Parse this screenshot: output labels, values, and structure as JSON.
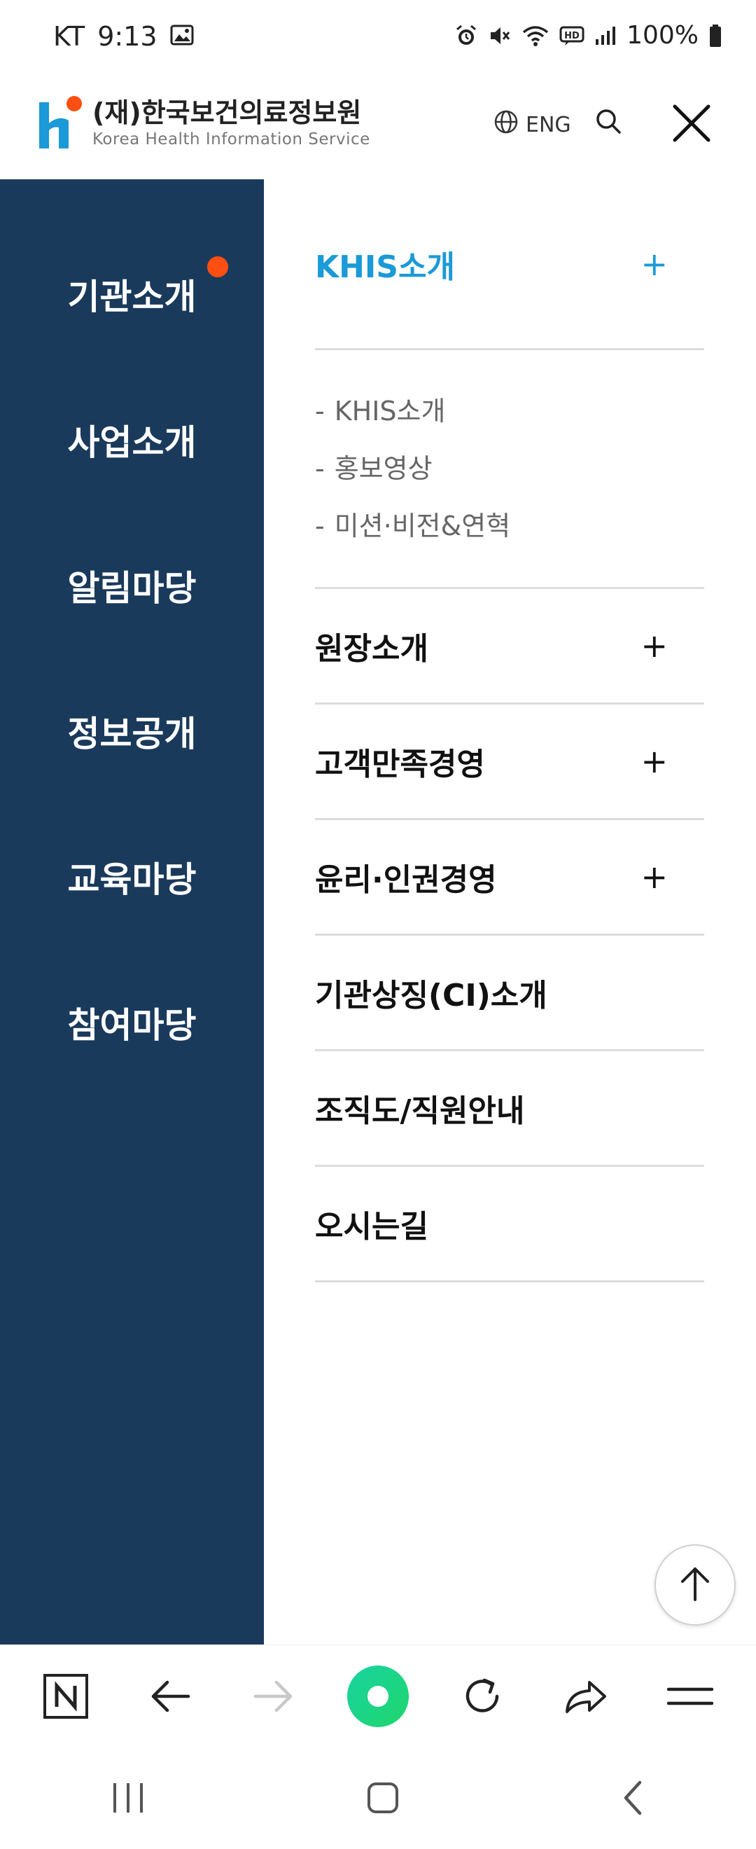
{
  "status_bar": {
    "carrier": "KT",
    "time": "9:13",
    "battery": "100%"
  },
  "header": {
    "logo_ko": "(재)한국보건의료정보원",
    "logo_en": "Korea Health Information Service",
    "lang_label": "ENG"
  },
  "sidebar": {
    "items": [
      {
        "label": "기관소개"
      },
      {
        "label": "사업소개"
      },
      {
        "label": "알림마당"
      },
      {
        "label": "정보공개"
      },
      {
        "label": "교육마당"
      },
      {
        "label": "참여마당"
      }
    ]
  },
  "menu": {
    "items": [
      {
        "label": "KHIS소개",
        "icon": "+"
      },
      {
        "label": "원장소개",
        "icon": "+"
      },
      {
        "label": "고객만족경영",
        "icon": "+"
      },
      {
        "label": "윤리·인권경영",
        "icon": "+"
      },
      {
        "label": "기관상징(CI)소개"
      },
      {
        "label": "조직도/직원안내"
      },
      {
        "label": "오시는길"
      }
    ],
    "sub_items": [
      {
        "dash": "-",
        "label": "KHIS소개"
      },
      {
        "dash": "-",
        "label": "홍보영상"
      },
      {
        "dash": "-",
        "label": "미션·비전&연혁"
      }
    ]
  },
  "colors": {
    "sidebar_bg": "#1a3a5c",
    "accent": "#1a9ad6",
    "notification_dot": "#ff4e12",
    "home_button": "#1fd68a"
  },
  "toolbar": {
    "icons": [
      "naver-icon",
      "back-arrow-icon",
      "forward-arrow-icon",
      "home-icon",
      "refresh-icon",
      "share-icon",
      "menu-icon"
    ]
  }
}
